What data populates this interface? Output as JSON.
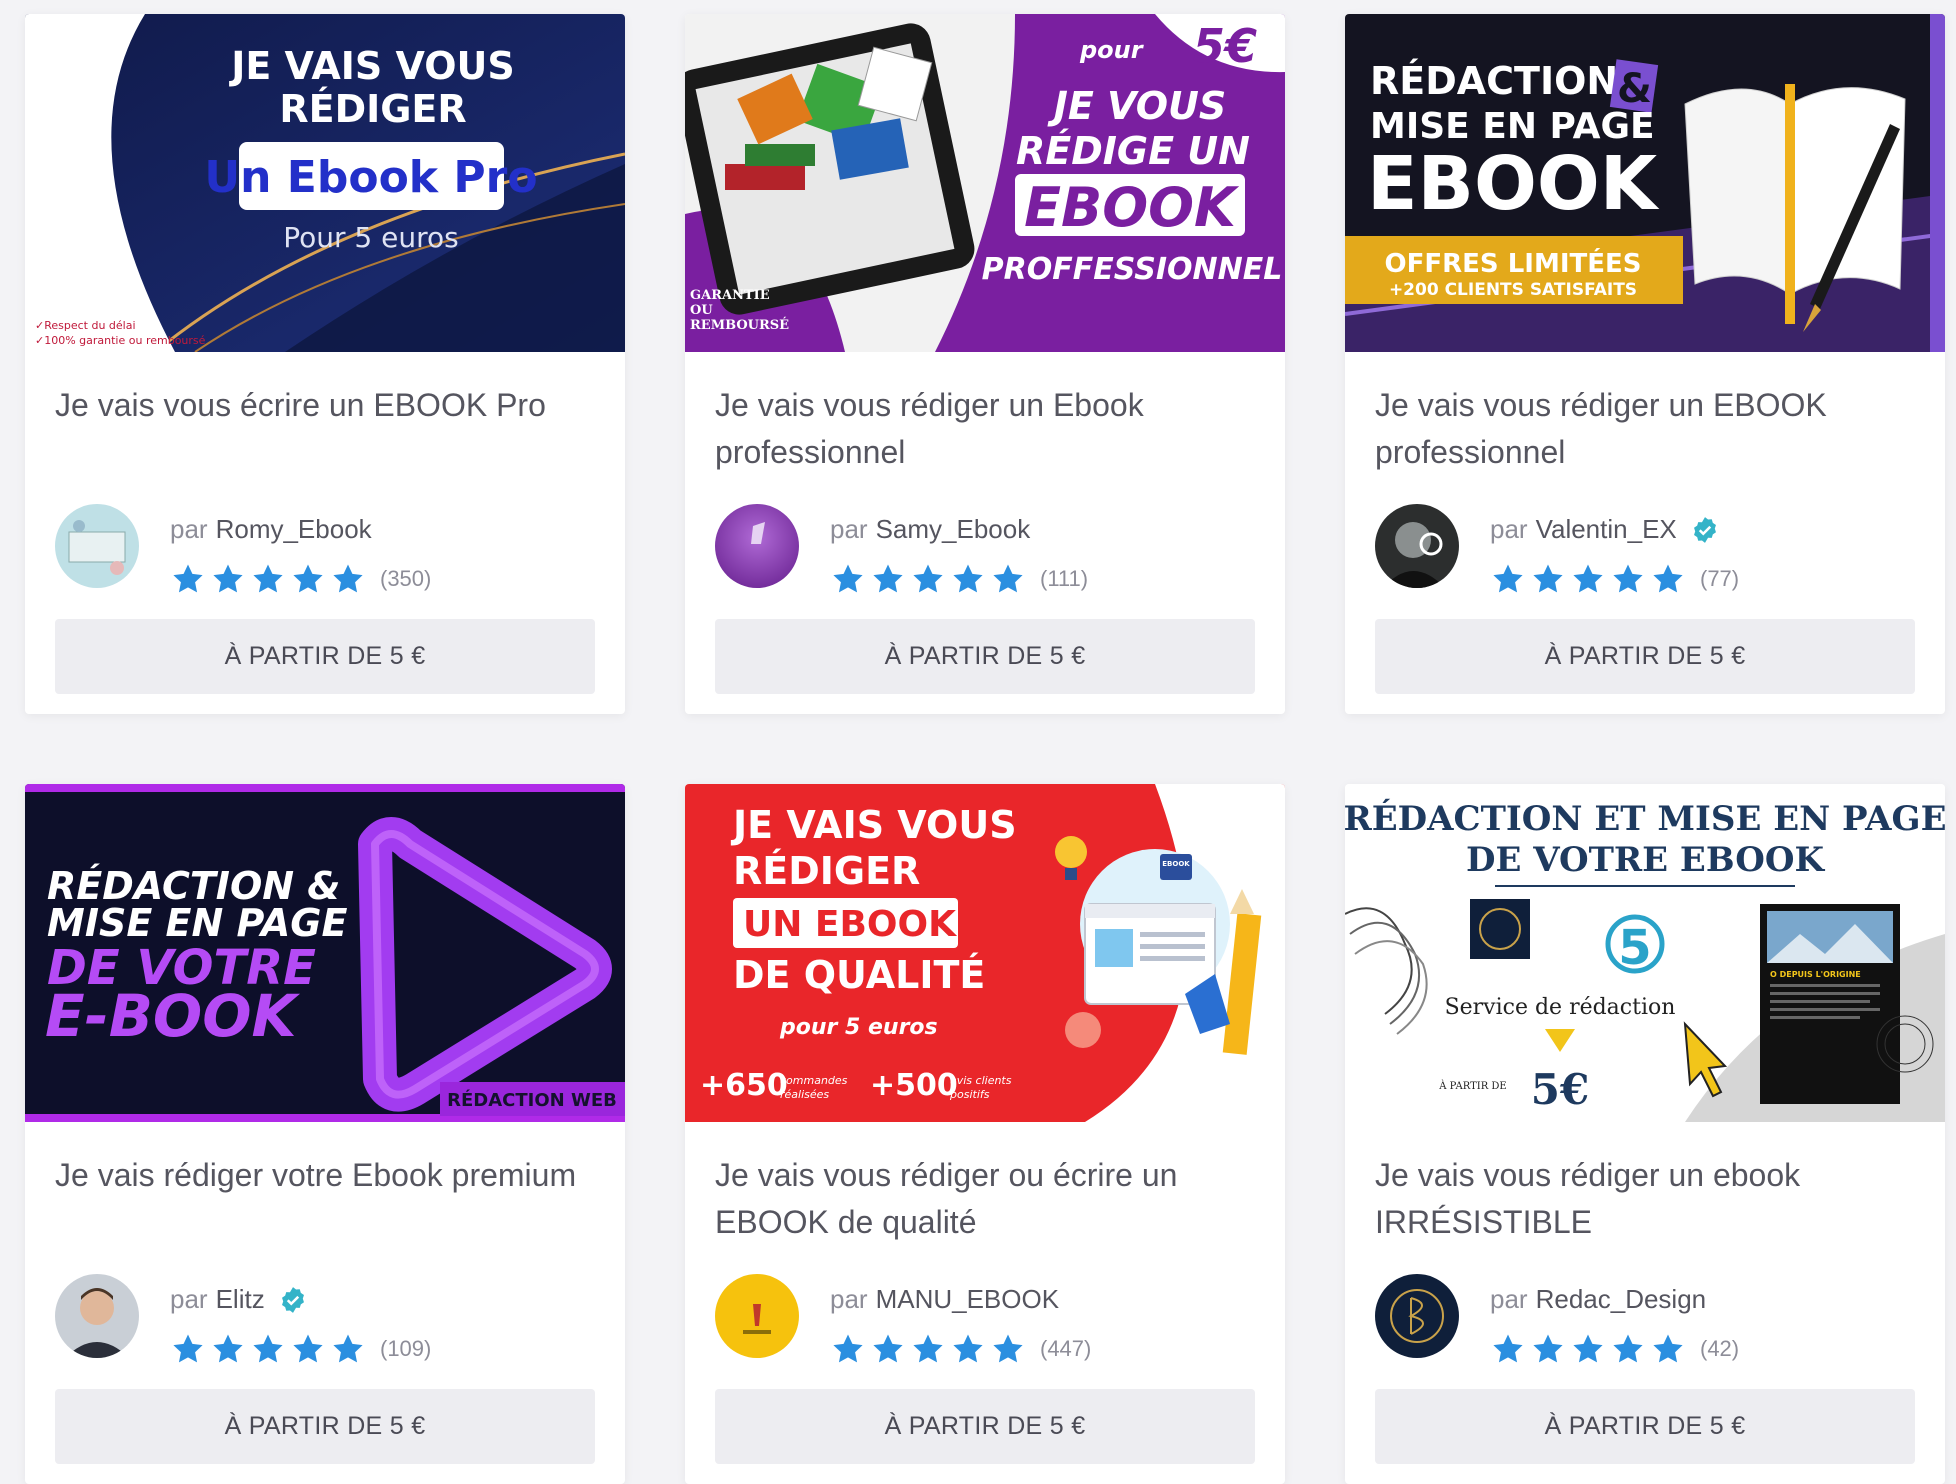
{
  "colors": {
    "star": "#2b8fe0",
    "verified": "#34b3c8",
    "title_text": "#55555f",
    "button_bg": "#ededf1"
  },
  "cards": [
    {
      "title": "Je vais vous écrire un EBOOK Pro",
      "seller_prefix": "par",
      "seller": "Romy_Ebook",
      "verified": false,
      "reviews": "(350)",
      "price": "À PARTIR DE 5 €",
      "thumb": {
        "line1": "JE VAIS VOUS",
        "line2": "RÉDIGER",
        "box": "Un Ebook Pro",
        "sub": "Pour 5 euros",
        "note1": "✓Respect du délai",
        "note2": "✓100% garantie ou remboursé"
      }
    },
    {
      "title": "Je vais vous rédiger un Ebook professionnel",
      "seller_prefix": "par",
      "seller": "Samy_Ebook",
      "verified": false,
      "reviews": "(111)",
      "price": "À PARTIR DE 5 €",
      "thumb": {
        "pour": "pour",
        "price": "5€",
        "line1": "JE VOUS",
        "line2": "RÉDIGE UN",
        "box": "EBOOK",
        "line3": "PROFFESSIONNEL",
        "badge1": "GARANTIE",
        "badge2": "OU",
        "badge3": "REMBOURSÉ"
      }
    },
    {
      "title": "Je vais vous rédiger un EBOOK professionnel",
      "seller_prefix": "par",
      "seller": "Valentin_EX",
      "verified": true,
      "reviews": "(77)",
      "price": "À PARTIR DE 5 €",
      "thumb": {
        "line1": "RÉDACTION",
        "amp": "&",
        "line2": "MISE EN PAGE",
        "line3": "EBOOK",
        "band1": "OFFRES LIMITÉES",
        "band2": "+200 CLIENTS SATISFAITS"
      }
    },
    {
      "title": "Je vais rédiger votre Ebook premium",
      "seller_prefix": "par",
      "seller": "Elitz",
      "verified": true,
      "reviews": "(109)",
      "price": "À PARTIR DE 5 €",
      "thumb": {
        "line1": "RÉDACTION &",
        "line2": "MISE EN PAGE",
        "line3": "DE VOTRE",
        "line4": "E-BOOK",
        "tag": "RÉDACTION WEB"
      }
    },
    {
      "title": "Je vais vous rédiger ou écrire un EBOOK de qualité",
      "seller_prefix": "par",
      "seller": "MANU_EBOOK",
      "verified": false,
      "reviews": "(447)",
      "price": "À PARTIR DE 5 €",
      "thumb": {
        "line1": "JE VAIS VOUS",
        "line2": "RÉDIGER",
        "box": "UN EBOOK",
        "line3": "DE QUALITÉ",
        "sub": "pour 5 euros",
        "stat1": "+650",
        "stat1a": "commandes",
        "stat1b": "réalisées",
        "stat2": "+500",
        "stat2a": "avis clients",
        "stat2b": "positifs",
        "ebook_icon": "EBOOK"
      }
    },
    {
      "title": "Je vais vous rédiger un ebook IRRÉSISTIBLE",
      "seller_prefix": "par",
      "seller": "Redac_Design",
      "verified": false,
      "reviews": "(42)",
      "price": "À PARTIR DE 5 €",
      "thumb": {
        "line1": "RÉDACTION ET MISE EN PAGE",
        "line2": "DE VOTRE EBOOK",
        "service": "Service de rédaction",
        "apartir": "À PARTIR DE",
        "price": "5€",
        "five": "5",
        "page_title": "O DEPUIS L'ORIGINE"
      }
    }
  ]
}
